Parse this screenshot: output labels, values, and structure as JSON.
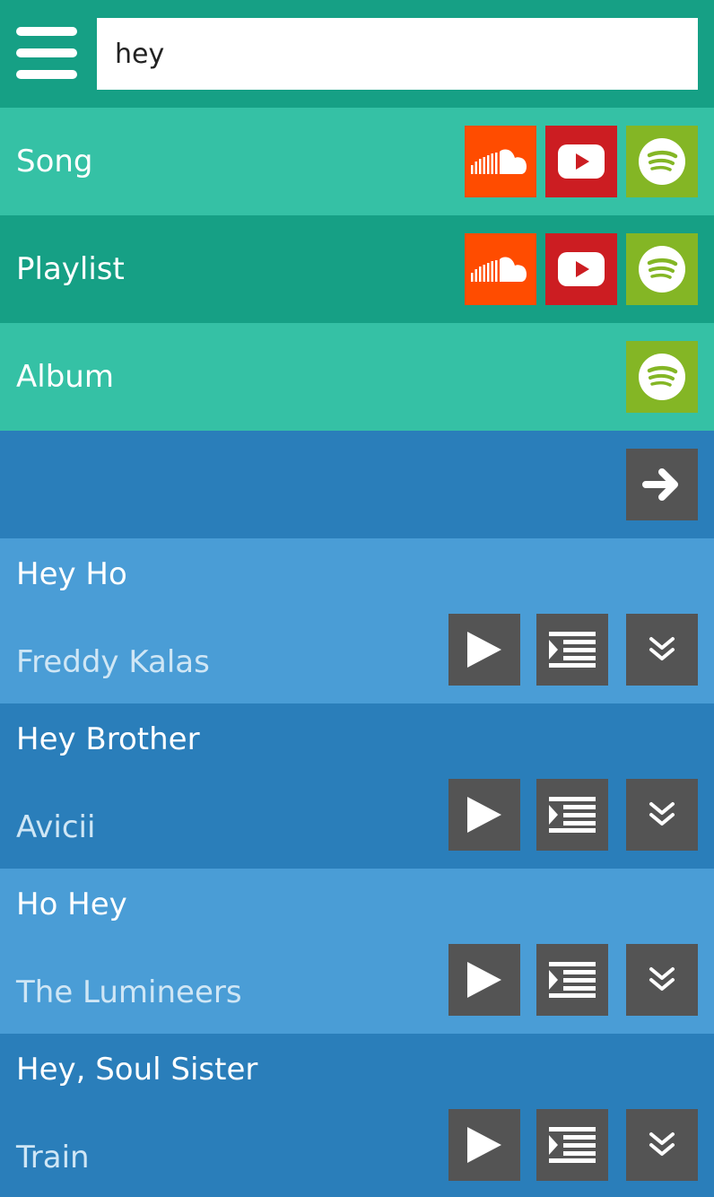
{
  "search": {
    "value": "hey"
  },
  "sources": [
    {
      "label": "Song",
      "services": [
        "soundcloud",
        "youtube",
        "spotify"
      ]
    },
    {
      "label": "Playlist",
      "services": [
        "soundcloud",
        "youtube",
        "spotify"
      ]
    },
    {
      "label": "Album",
      "services": [
        "spotify"
      ]
    }
  ],
  "tracks": [
    {
      "title": "Hey Ho",
      "artist": "Freddy Kalas"
    },
    {
      "title": "Hey Brother",
      "artist": "Avicii"
    },
    {
      "title": "Ho Hey",
      "artist": "The Lumineers"
    },
    {
      "title": "Hey, Soul Sister",
      "artist": "Train"
    }
  ],
  "icons": {
    "menu": "hamburger-menu-icon",
    "soundcloud": "soundcloud-icon",
    "youtube": "youtube-icon",
    "spotify": "spotify-icon",
    "next": "arrow-right-icon",
    "play": "play-icon",
    "queue": "add-to-queue-icon",
    "expand": "double-chevron-down-icon"
  },
  "colors": {
    "header": "#16a085",
    "row_light_green": "#35c1a5",
    "row_dark_green": "#16a085",
    "soundcloud": "#ff4c00",
    "youtube": "#cc1d22",
    "spotify": "#84b625",
    "row_blue_dark": "#2a7eba",
    "row_blue_light": "#4a9dd6",
    "button_dark": "#545454"
  }
}
